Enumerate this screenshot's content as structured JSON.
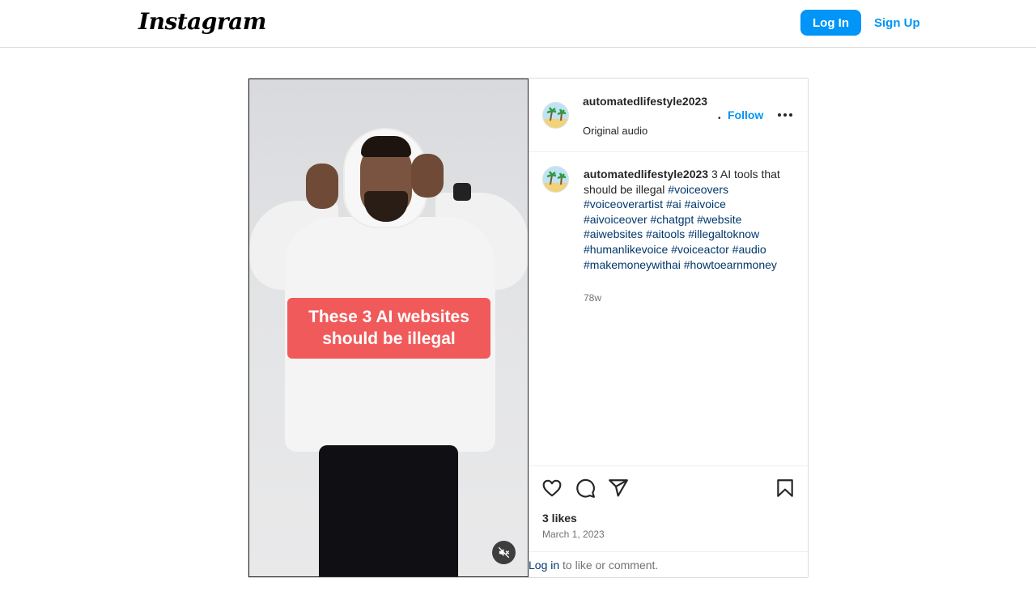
{
  "nav": {
    "logo": "Instagram",
    "login_label": "Log In",
    "signup_label": "Sign Up"
  },
  "post": {
    "video_overlay": {
      "line1": "These 3 AI websites",
      "line2": "should be illegal",
      "mute_icon": "muted-speaker-icon"
    },
    "header": {
      "username": "automatedlifestyle2023",
      "audio": "Original audio",
      "separator": "•",
      "follow_label": "Follow",
      "more_icon": "more-options-icon"
    },
    "caption": {
      "username": "automatedlifestyle2023",
      "text": "3 AI tools that should be illegal",
      "hashtags": [
        "#voiceovers",
        "#voiceoverartist",
        "#ai",
        "#aivoice",
        "#aivoiceover",
        "#chatgpt",
        "#website",
        "#aiwebsites",
        "#aitools",
        "#illegaltoknow",
        "#humanlikevoice",
        "#voiceactor",
        "#audio",
        "#makemoneywithai",
        "#howtoearnmoney"
      ],
      "age": "78w"
    },
    "actions": {
      "icons": [
        "heart-icon",
        "comment-icon",
        "share-icon",
        "bookmark-icon"
      ],
      "likes": "3 likes",
      "date": "March 1, 2023"
    },
    "comment_prompt": {
      "link": "Log in",
      "text": " to like or comment."
    }
  },
  "colors": {
    "accent": "#0095f6",
    "link": "#00376b",
    "overlay": "#f15a5a"
  }
}
